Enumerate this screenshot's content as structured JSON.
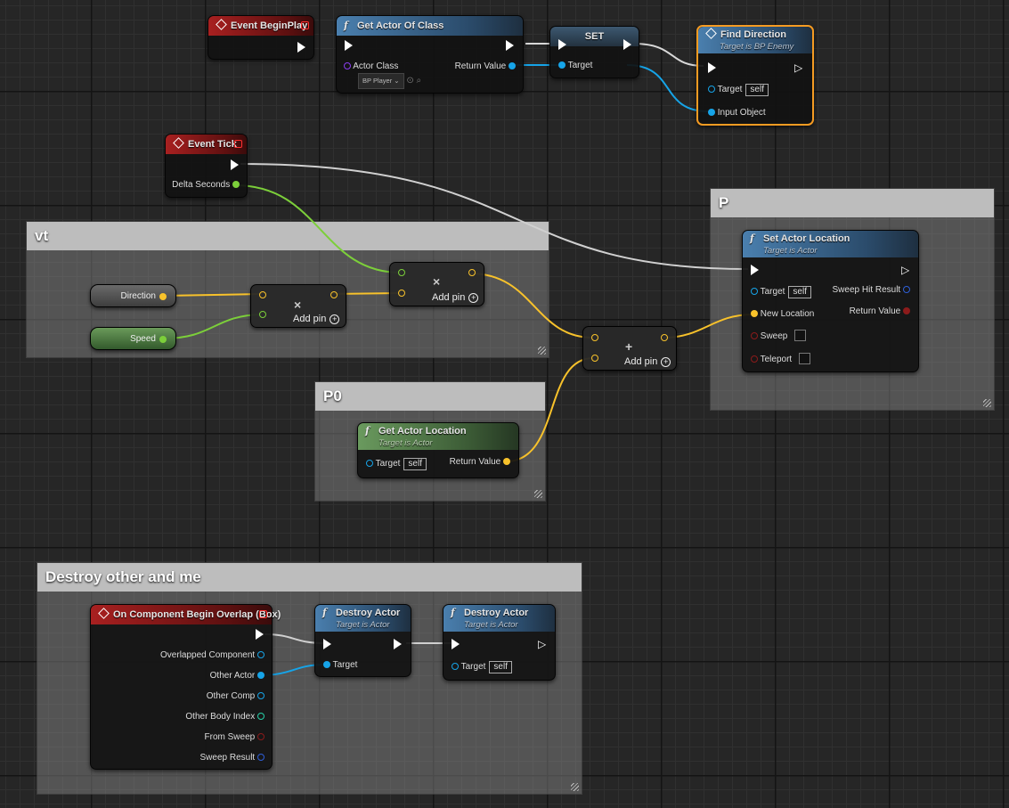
{
  "colors": {
    "exec": "#ffffff",
    "object": "#16a4e8",
    "vector": "#f8c22b",
    "float": "#9bde4f",
    "bool": "#8c1b1b",
    "struct": "#2e5fd8",
    "selected": "#f59b22"
  },
  "comments": {
    "vt": "vt",
    "p": "P",
    "p0": "P0",
    "destroy": "Destroy other and me"
  },
  "nodes": {
    "begin_play": {
      "title": "Event BeginPlay"
    },
    "get_actor_of_class": {
      "title": "Get Actor Of Class",
      "pin_actor_class": "Actor Class",
      "class_value": "BP Player",
      "pin_return": "Return Value"
    },
    "set_node": {
      "title": "SET",
      "pin_target": "Target"
    },
    "find_direction": {
      "title": "Find Direction",
      "subtitle": "Target is BP Enemy",
      "pin_target": "Target",
      "self": "self",
      "pin_input": "Input Object"
    },
    "event_tick": {
      "title": "Event Tick",
      "pin_delta": "Delta Seconds"
    },
    "direction_var": {
      "label": "Direction"
    },
    "speed_var": {
      "label": "Speed"
    },
    "multiply": {
      "op": "×",
      "add_pin": "Add pin"
    },
    "multiply2": {
      "op": "×",
      "add_pin": "Add pin"
    },
    "add_node": {
      "op": "+",
      "add_pin": "Add pin"
    },
    "set_actor_location": {
      "title": "Set Actor Location",
      "subtitle": "Target is Actor",
      "pin_target": "Target",
      "self": "self",
      "pin_new_loc": "New Location",
      "pin_sweep": "Sweep",
      "pin_teleport": "Teleport",
      "out_sweep_hit": "Sweep Hit Result",
      "out_return": "Return Value"
    },
    "get_actor_location": {
      "title": "Get Actor Location",
      "subtitle": "Target is Actor",
      "pin_target": "Target",
      "self": "self",
      "pin_return": "Return Value"
    },
    "overlap": {
      "title": "On Component Begin Overlap (Box)",
      "pins": [
        "Overlapped Component",
        "Other Actor",
        "Other Comp",
        "Other Body Index",
        "From Sweep",
        "Sweep Result"
      ]
    },
    "destroy1": {
      "title": "Destroy Actor",
      "subtitle": "Target is Actor",
      "pin_target": "Target"
    },
    "destroy2": {
      "title": "Destroy Actor",
      "subtitle": "Target is Actor",
      "pin_target": "Target",
      "self": "self"
    }
  },
  "icons": {
    "event": "diamond-icon",
    "function": "function-icon",
    "close": "red-square-icon"
  }
}
